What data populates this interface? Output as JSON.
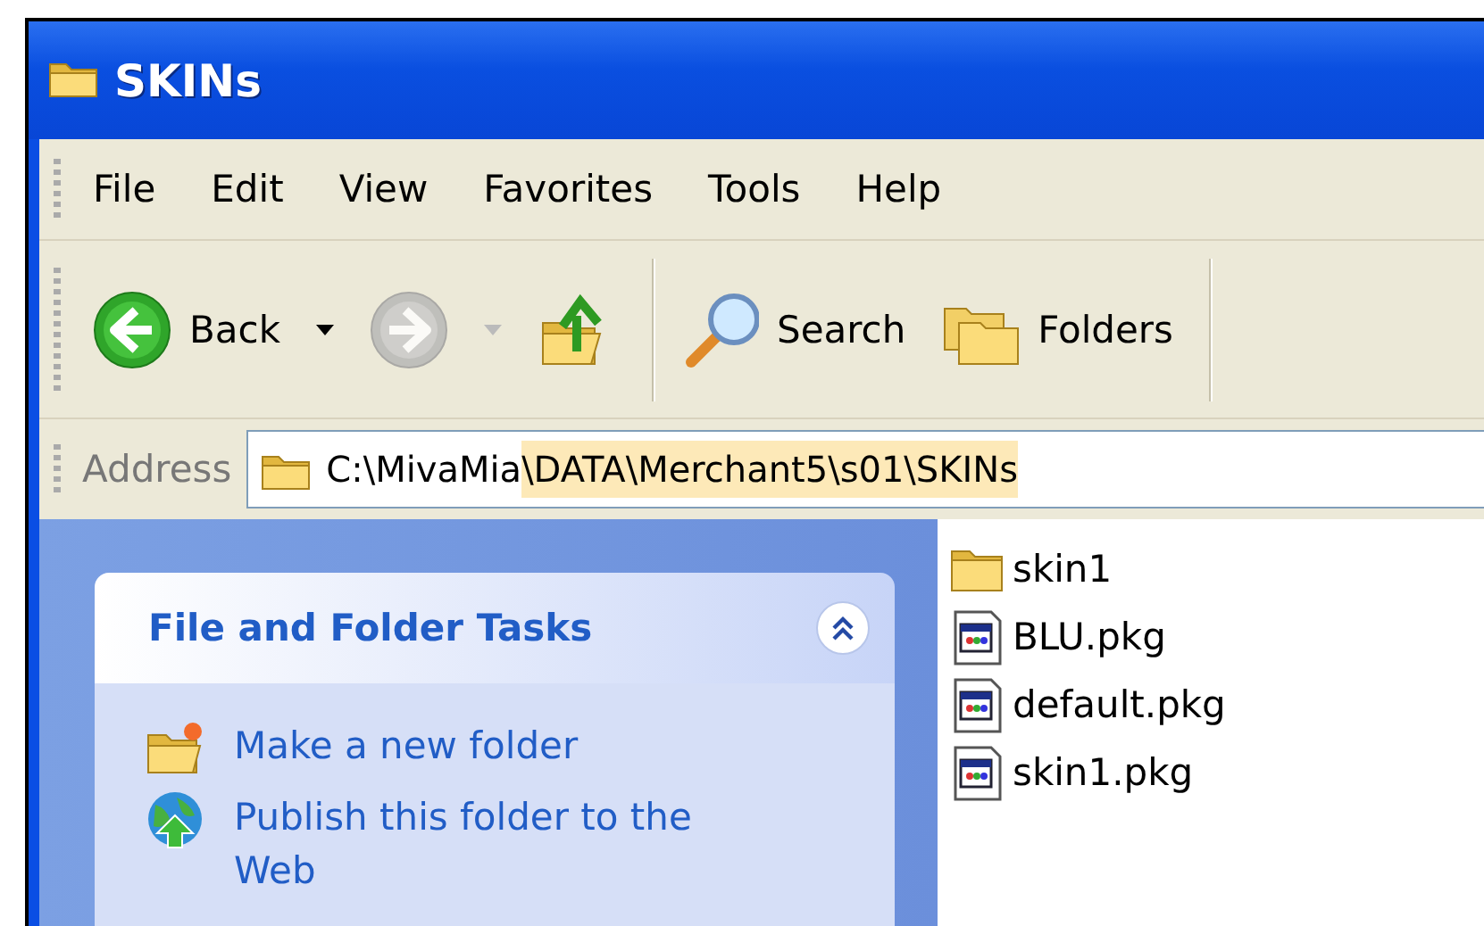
{
  "window": {
    "title": "SKINs"
  },
  "menu": [
    "File",
    "Edit",
    "View",
    "Favorites",
    "Tools",
    "Help"
  ],
  "toolbar": [
    {
      "kind": "back",
      "label": "Back",
      "disabled": false
    },
    {
      "kind": "forward",
      "disabled": true
    },
    {
      "kind": "up",
      "disabled": false
    },
    {
      "kind": "separator"
    },
    {
      "kind": "search",
      "label": "Search",
      "disabled": false
    },
    {
      "kind": "folders",
      "label": "Folders",
      "disabled": false
    },
    {
      "kind": "separator"
    }
  ],
  "address": {
    "label": "Address",
    "parts": [
      {
        "text": "C:\\MivaMia",
        "highlighted": false
      },
      {
        "text": "\\DATA\\Merchant5\\s01\\SKINs",
        "highlighted": true
      }
    ]
  },
  "tasks": {
    "title": "File and Folder Tasks",
    "expanded": true,
    "items": [
      {
        "kind": "new-folder",
        "label": "Make a new folder"
      },
      {
        "kind": "publish",
        "label": "Publish this folder to the Web"
      }
    ]
  },
  "files": [
    {
      "kind": "folder",
      "name": "skin1"
    },
    {
      "kind": "package",
      "name": "BLU.pkg"
    },
    {
      "kind": "package",
      "name": "default.pkg"
    },
    {
      "kind": "package",
      "name": "skin1.pkg"
    }
  ]
}
